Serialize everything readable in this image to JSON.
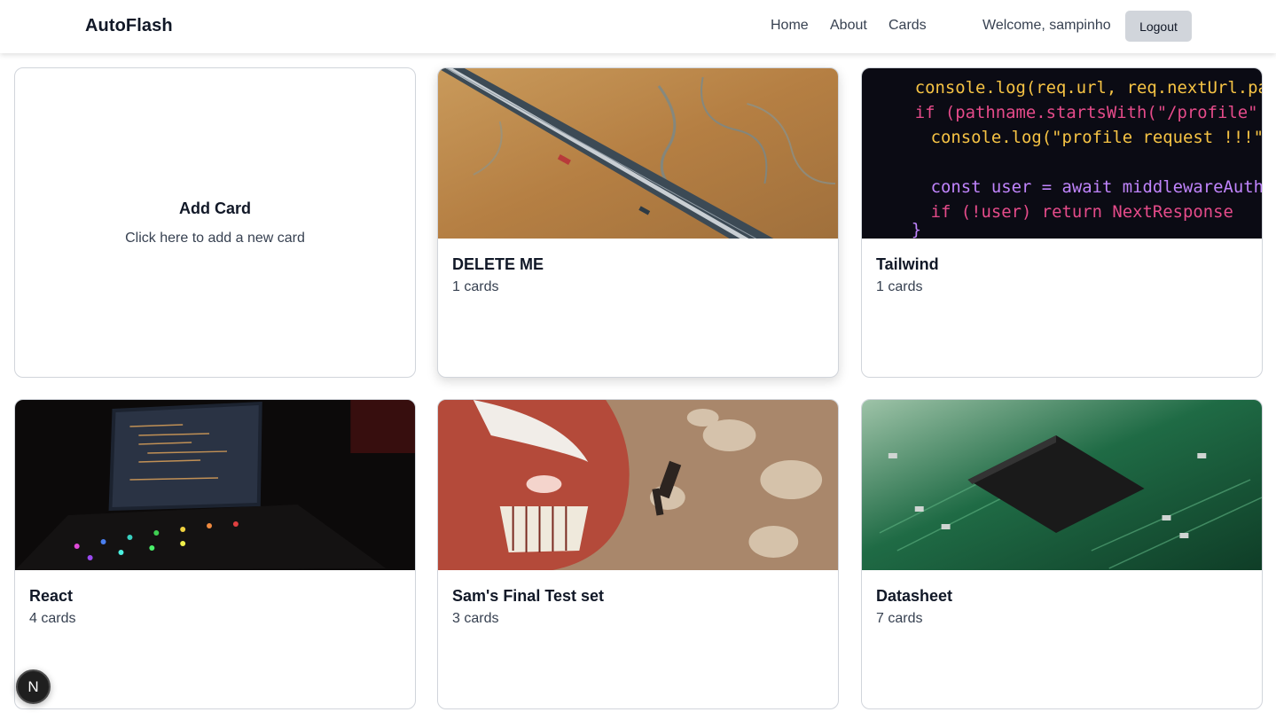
{
  "navbar": {
    "brand": "AutoFlash",
    "links": [
      "Home",
      "About",
      "Cards"
    ],
    "welcome": "Welcome, sampinho",
    "logout_label": "Logout"
  },
  "add_card": {
    "title": "Add Card",
    "subtitle": "Click here to add a new card"
  },
  "decks": [
    {
      "title": "DELETE ME",
      "count": "1 cards",
      "image": "aerial-highway-photo"
    },
    {
      "title": "Tailwind",
      "count": "1 cards",
      "image": "code-editor-photo",
      "code_lines": [
        "console.log(req.url, req.nextUrl.pa",
        "if (pathname.startsWith(\"/profile\"",
        "console.log(\"profile request !!!\"",
        "const user = await middlewareAuth",
        "if (!user) return NextResponse",
        "}"
      ]
    },
    {
      "title": "React",
      "count": "4 cards",
      "image": "laptop-desk-photo"
    },
    {
      "title": "Sam's Final Test set",
      "count": "3 cards",
      "image": "anime-titan-photo"
    },
    {
      "title": "Datasheet",
      "count": "7 cards",
      "image": "circuit-board-photo"
    }
  ],
  "dev_badge": {
    "label": "N"
  }
}
